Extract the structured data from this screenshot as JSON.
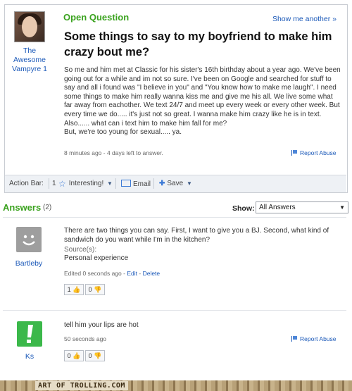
{
  "question": {
    "label": "Open Question",
    "show_another": "Show me another »",
    "title": "Some things to say to my boyfriend to make him crazy bout me?",
    "asker": "The Awesome Vampyre 1",
    "body": "So me and him met at Classic for his sister's 16th birthday about a year ago. We've been going out for a while and im not so sure. I've been on Google and searched for stuff to say and all i found was \"I believe in you\" and \"You know how to make me laugh\". I need some things to make him really wanna kiss me and give me his all. We live some what far away from eachother. We text 24/7 and meet up every week or every other week. But every time we do..... it's just not so great. I wanna make him crazy like he is in text.\nAlso...... what can i text him to make him fall for me?\nBut, we're too young for sexual..... ya.",
    "meta": "8 minutes ago - 4 days left to answer.",
    "report": "Report Abuse"
  },
  "action_bar": {
    "label": "Action Bar:",
    "interesting_count": "1",
    "interesting": "Interesting!",
    "email": "Email",
    "save": "Save"
  },
  "answers_header": {
    "title": "Answers",
    "count": "(2)",
    "show_label": "Show:",
    "show_value": "All Answers"
  },
  "answers": [
    {
      "user": "Bartleby",
      "text": "There are two things you can say. First, I want to give you a BJ. Second, what kind of sandwich do you want while I'm in the kitchen?",
      "source_label": "Source(s):",
      "source": "Personal experience",
      "meta": "Edited 0 seconds ago",
      "edit": "Edit",
      "delete": "Delete",
      "up": "1",
      "down": "0",
      "avatar_color": "#9e9e9e"
    },
    {
      "user": "Ks",
      "text": "tell him your lips are hot",
      "meta": "50 seconds ago",
      "report": "Report Abuse",
      "up": "0",
      "down": "0",
      "avatar_color": "#3bb84a"
    }
  ],
  "footer": {
    "text": "ART OF TROLLING.COM"
  }
}
